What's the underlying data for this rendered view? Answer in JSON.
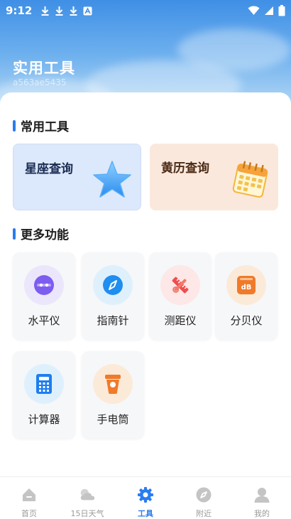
{
  "status_bar": {
    "time": "9:12"
  },
  "header": {
    "title": "实用工具",
    "subtitle": "a563ae5435"
  },
  "common_tools": {
    "title": "常用工具",
    "items": [
      {
        "label": "星座查询",
        "icon": "star-icon",
        "bg": "#dce8fb",
        "color": "#1a2b52"
      },
      {
        "label": "黄历查询",
        "icon": "calendar-icon",
        "bg": "#fbe8dd",
        "color": "#4a2a14"
      }
    ]
  },
  "more_features": {
    "title": "更多功能",
    "items": [
      {
        "label": "水平仪",
        "icon": "level-icon",
        "color": "#7d5cf0",
        "bg": "#ebe6fb"
      },
      {
        "label": "指南针",
        "icon": "compass-icon",
        "color": "#1e8ef1",
        "bg": "#dff0fd"
      },
      {
        "label": "测距仪",
        "icon": "ruler-icon",
        "color": "#ee4e4e",
        "bg": "#fde7e7"
      },
      {
        "label": "分贝仪",
        "icon": "decibel-icon",
        "color": "#f07a2a",
        "bg": "#fcead9"
      },
      {
        "label": "计算器",
        "icon": "calculator-icon",
        "color": "#1e7ef0",
        "bg": "#dff0fd"
      },
      {
        "label": "手电筒",
        "icon": "flashlight-icon",
        "color": "#f07a2a",
        "bg": "#fcead9"
      }
    ]
  },
  "tabbar": {
    "items": [
      {
        "label": "首页",
        "icon": "home-icon",
        "active": false
      },
      {
        "label": "15日天气",
        "icon": "weather-icon",
        "active": false
      },
      {
        "label": "工具",
        "icon": "tools-gear-icon",
        "active": true
      },
      {
        "label": "附近",
        "icon": "nearby-compass-icon",
        "active": false
      },
      {
        "label": "我的",
        "icon": "profile-icon",
        "active": false
      }
    ]
  },
  "colors": {
    "accent": "#2a7cf0",
    "inactive": "#c4c4c4"
  }
}
